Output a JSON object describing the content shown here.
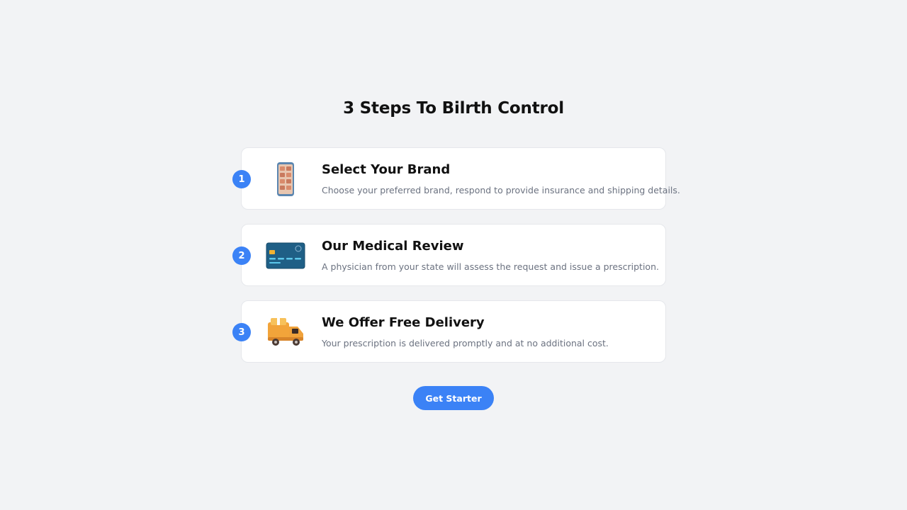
{
  "page": {
    "title": "3 Steps To Bilrth Control"
  },
  "steps": [
    {
      "number": "1",
      "icon": "smartphone-shopping-icon",
      "title": "Select Your Brand",
      "description": "Choose your preferred brand, respond to provide insurance and shipping details."
    },
    {
      "number": "2",
      "icon": "credit-card-icon",
      "title": "Our Medical Review",
      "description": "A physician from your state will assess the request and issue a prescription."
    },
    {
      "number": "3",
      "icon": "delivery-truck-icon",
      "title": "We Offer Free Delivery",
      "description": "Your prescription is delivered promptly and at no additional cost."
    }
  ],
  "cta": {
    "label": "Get Starter"
  },
  "colors": {
    "accent": "#3b82f6",
    "background": "#f2f3f5",
    "card": "#ffffff",
    "muted_text": "#6b7280"
  }
}
